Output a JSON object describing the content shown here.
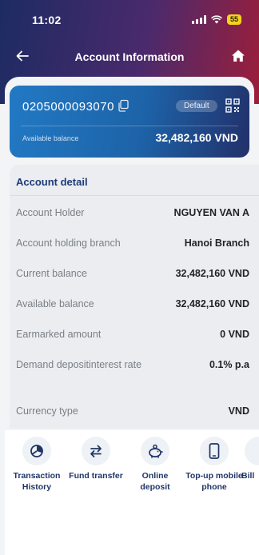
{
  "status_bar": {
    "time": "11:02",
    "battery": "55"
  },
  "nav": {
    "title": "Account Information"
  },
  "account_card": {
    "account_number": "0205000093070",
    "badge": "Default",
    "balance_label": "Available balance",
    "balance_value": "32,482,160 VND"
  },
  "detail": {
    "title": "Account detail",
    "rows": [
      {
        "label": "Account Holder",
        "value": "NGUYEN VAN A"
      },
      {
        "label": "Account holding branch",
        "value": "Hanoi Branch"
      },
      {
        "label": "Current balance",
        "value": "32,482,160 VND"
      },
      {
        "label": "Available balance",
        "value": "32,482,160 VND"
      },
      {
        "label": "Earmarked amount",
        "value": "0 VND"
      },
      {
        "label": "Demand depositinterest rate",
        "value": "0.1% p.a"
      },
      {
        "label": "Currency type",
        "value": "VND"
      }
    ]
  },
  "quick_actions": [
    {
      "label": "Transaction History",
      "icon": "pie-chart-icon"
    },
    {
      "label": "Fund transfer",
      "icon": "transfer-arrows-icon"
    },
    {
      "label": "Online deposit",
      "icon": "piggy-bank-icon"
    },
    {
      "label": "Top-up mobile phone",
      "icon": "mobile-phone-icon"
    },
    {
      "label": "Bill",
      "icon": "bill-icon"
    }
  ],
  "colors": {
    "header_start": "#1d2b63",
    "header_end": "#9c1e3a",
    "card_start": "#2279c4",
    "card_end": "#22306a",
    "title_blue": "#1d3a7a",
    "battery": "#f5d31a"
  }
}
